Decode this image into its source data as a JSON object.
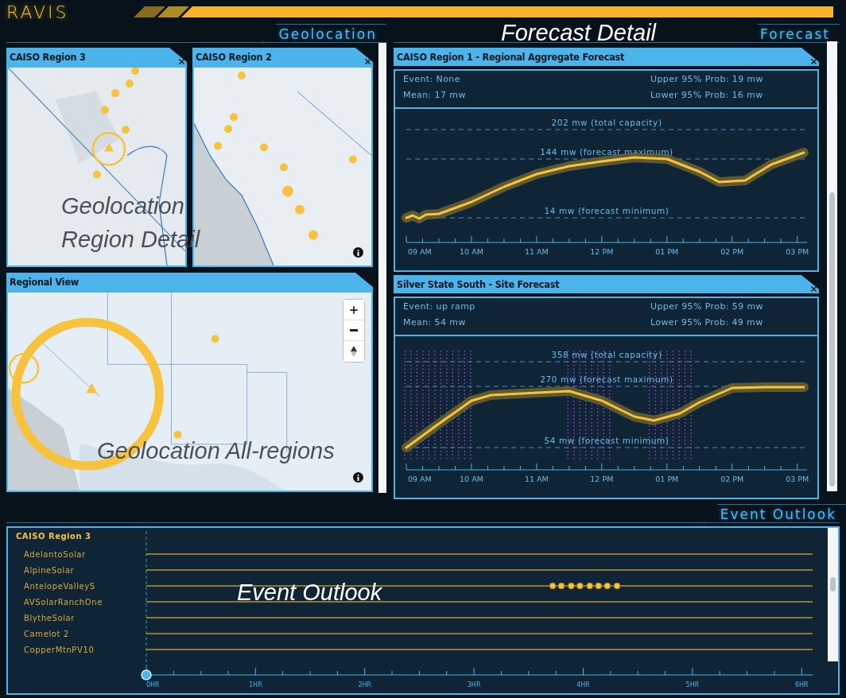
{
  "app": {
    "logo": "RAVIS"
  },
  "geolocation": {
    "heading": "Geolocation",
    "annotation": "Geolocation Region Detail",
    "region_maps": [
      {
        "title": "CAISO Region 3",
        "kind": "picture"
      },
      {
        "title": "CAISO Region 2",
        "kind": "picture"
      }
    ],
    "regional_view": {
      "title": "Regional View",
      "kind": "picture",
      "annotation": "Geolocation All-regions"
    }
  },
  "forecast": {
    "heading": "Forecast",
    "annotation": "Forecast Detail",
    "panels": [
      {
        "title": "CAISO Region 1 - Regional Aggregate Forecast",
        "kind": "aggregate",
        "event": "Event: None",
        "mean": "Mean: 17 mw",
        "upper": "Upper 95% Prob: 19 mw",
        "lower": "Lower 95% Prob: 16 mw",
        "reference_lines": [
          "202 mw (total capacity)",
          "144 mw (forecast maximum)",
          "14 mw (forecast minimum)"
        ],
        "x_ticks": [
          "09 AM",
          "10 AM",
          "11 AM",
          "12 PM",
          "01 PM",
          "02 PM",
          "03 PM"
        ]
      },
      {
        "title": "Silver State South - Site Forecast",
        "kind": "site",
        "event": "Event: up ramp",
        "mean": "Mean: 54 mw",
        "upper": "Upper 95% Prob: 59 mw",
        "lower": "Lower 95% Prob: 49 mw",
        "reference_lines": [
          "358 mw (total capacity)",
          "270 mw (forecast maximum)",
          "54 mw (forecast minimum)"
        ],
        "x_ticks": [
          "09 AM",
          "10 AM",
          "11 AM",
          "12 PM",
          "01 PM",
          "02 PM",
          "03 PM"
        ]
      }
    ]
  },
  "event_outlook": {
    "heading": "Event Outlook",
    "annotation": "Event Outlook",
    "group": "CAISO Region 3",
    "rows": [
      {
        "name": "AdelantoSolar",
        "events": false
      },
      {
        "name": "AlpineSolar",
        "events": false
      },
      {
        "name": "AntelopeValleyS",
        "events": true
      },
      {
        "name": "AVSolarRanchOne",
        "events": false
      },
      {
        "name": "BlytheSolar",
        "events": false
      },
      {
        "name": "Camelot 2",
        "events": false
      },
      {
        "name": "CopperMtnPV10",
        "events": false
      }
    ],
    "time_ticks": [
      "0HR",
      "1HR",
      "2HR",
      "3HR",
      "4HR",
      "5HR",
      "6HR"
    ]
  }
}
